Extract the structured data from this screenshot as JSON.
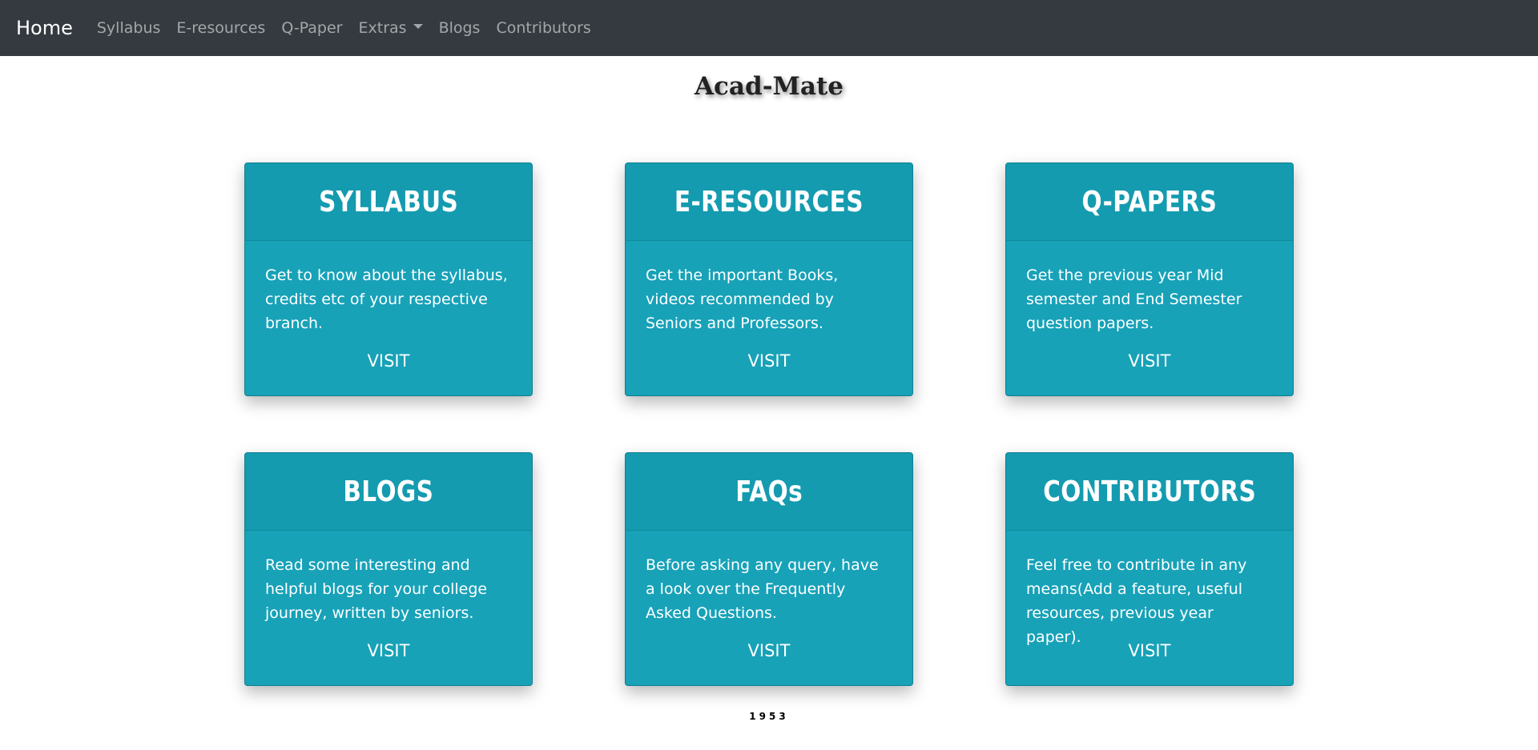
{
  "nav": {
    "brand": "Home",
    "items": [
      {
        "label": "Syllabus"
      },
      {
        "label": "E-resources"
      },
      {
        "label": "Q-Paper"
      },
      {
        "label": "Extras"
      },
      {
        "label": "Blogs"
      },
      {
        "label": "Contributors"
      }
    ]
  },
  "site_title": "Acad-Mate",
  "cards": [
    {
      "title": "SYLLABUS",
      "text": "Get to know about the syllabus, credits etc of your respective branch.",
      "visit": "VISIT"
    },
    {
      "title": "E-RESOURCES",
      "text": "Get the important Books, videos recommended by Seniors and Professors.",
      "visit": "VISIT"
    },
    {
      "title": "Q-PAPERS",
      "text": "Get the previous year Mid semester and End Semester question papers.",
      "visit": "VISIT"
    },
    {
      "title": "BLOGS",
      "text": "Read some interesting and helpful blogs for your college journey, written by seniors.",
      "visit": "VISIT"
    },
    {
      "title": "FAQs",
      "text": "Before asking any query, have a look over the Frequently Asked Questions.",
      "visit": "VISIT"
    },
    {
      "title": "CONTRIBUTORS",
      "text": "Feel free to contribute in any means(Add a feature, useful resources, previous year paper).",
      "visit": "VISIT"
    }
  ],
  "footer": {
    "counter": "1953"
  },
  "colors": {
    "navbar": "#343a40",
    "card": "#17a2b8"
  }
}
